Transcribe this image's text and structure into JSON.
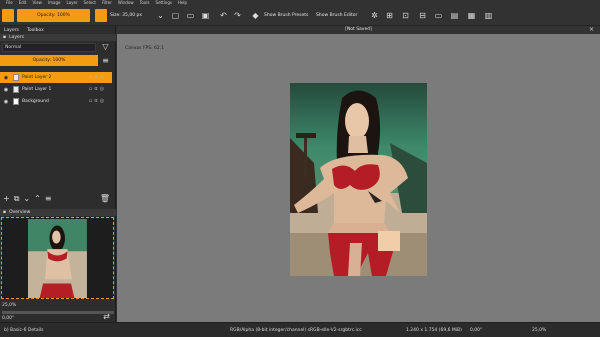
{
  "menu": [
    "File",
    "Edit",
    "View",
    "Image",
    "Layer",
    "Select",
    "Filter",
    "Window",
    "Tools",
    "Settings",
    "Help"
  ],
  "toolbar": {
    "opacity_label": "Opacity: 100%",
    "size_label": "Size: 35,00 px",
    "show_brush_presets": "Show Brush Presets",
    "show_brush_editor": "Show Brush Editor"
  },
  "dock": {
    "tab_layers": "Layers",
    "tab_toolbox": "Toolbox",
    "panel_title": "Layers",
    "blend_mode": "Normal",
    "opacity_label": "Opacity:  100%",
    "layers": [
      {
        "name": "Paint Layer 2",
        "selected": true
      },
      {
        "name": "Paint Layer 1",
        "selected": false
      },
      {
        "name": "Background",
        "selected": false
      }
    ],
    "overview_title": "Overview",
    "zoom_value": "25,0%",
    "angle_value": "0,00°"
  },
  "canvas": {
    "doc_title": "[Not Saved]",
    "fps_label": "Canvas FPS: 62,1"
  },
  "status": {
    "brush": "b) Basic-6 Details",
    "color_space": "RGB/Alpha (8-bit integer/channel)  sRGB-elle-V2-srgbtrc.icc",
    "dimensions": "1.240 x 1.754 (69,6 MiB)",
    "rotation": "0,00°",
    "zoom": "25,0%"
  },
  "colors": {
    "accent": "#f39c12",
    "canvas_bg": "#7b7b7b",
    "panel_bg": "#2d2d2d"
  }
}
